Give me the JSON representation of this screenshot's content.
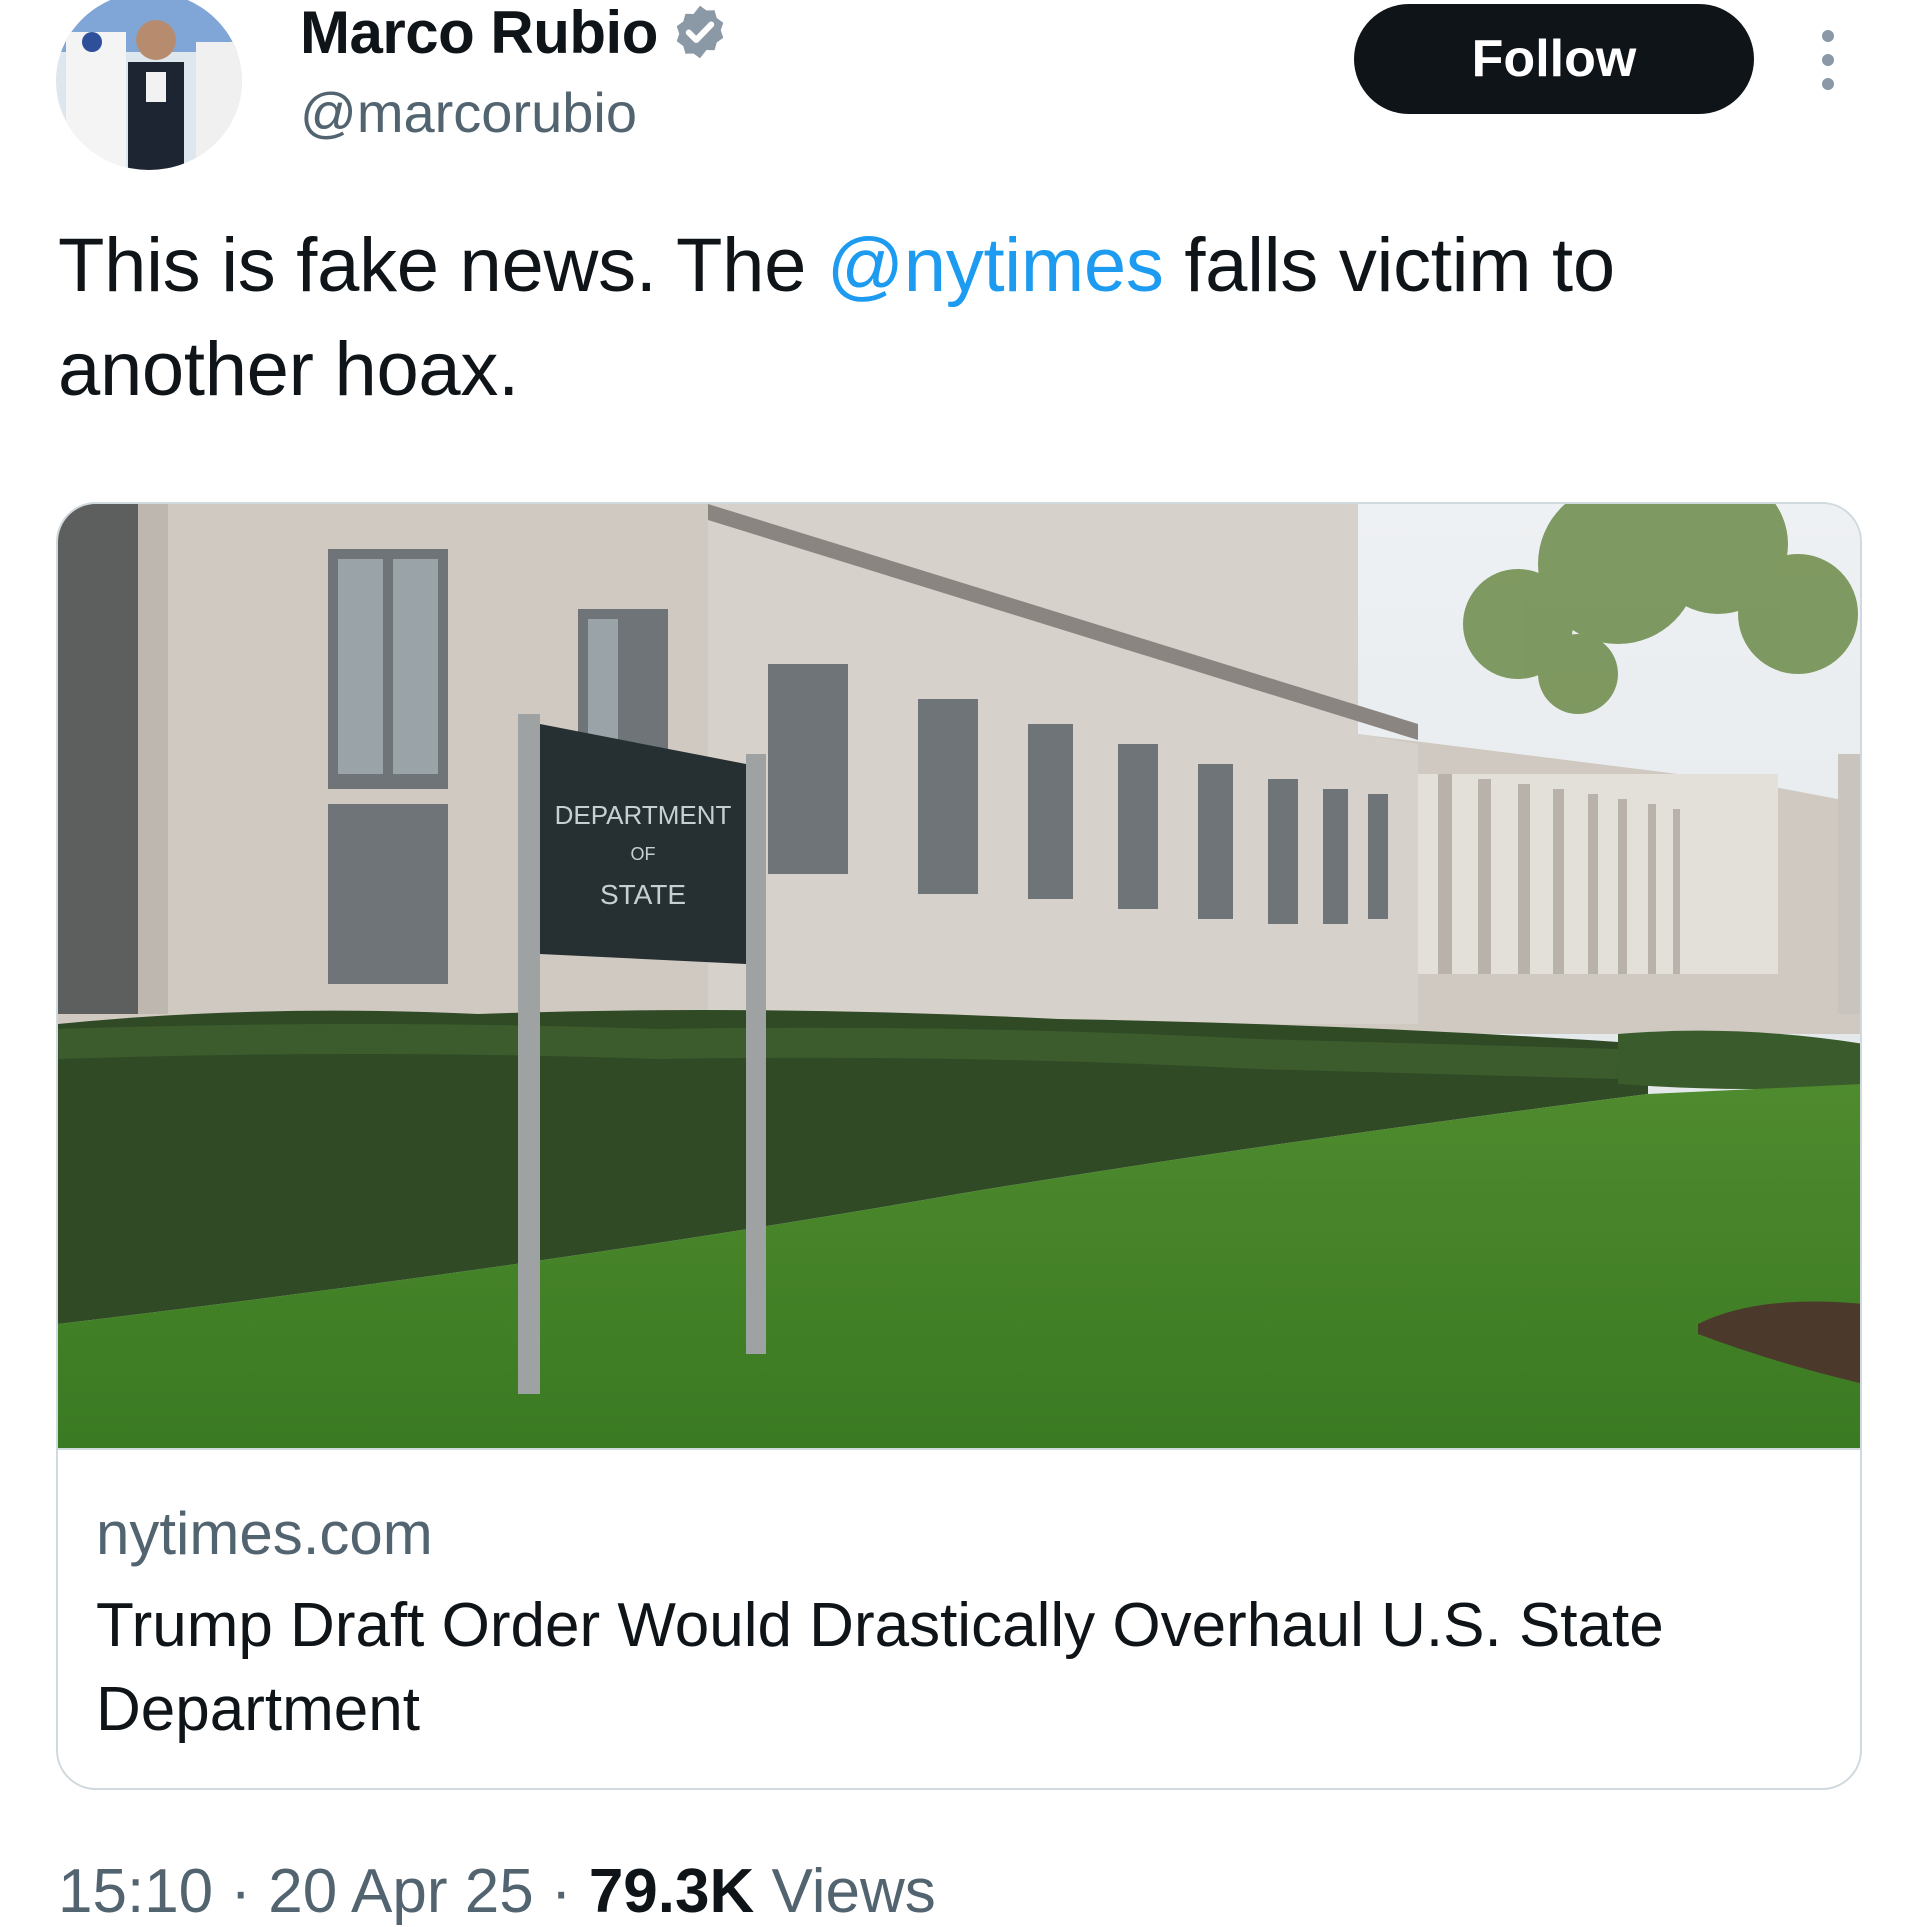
{
  "author": {
    "display_name": "Marco Rubio",
    "handle": "@marcorubio",
    "verified": true
  },
  "follow_button": {
    "label": "Follow"
  },
  "more_menu": {
    "icon": "more-options-icon"
  },
  "tweet": {
    "text_before": "This is fake news. The ",
    "mention": "@nytimes",
    "text_after": " falls victim to another hoax."
  },
  "link_card": {
    "image_sign_text_top": "DEPARTMENT",
    "image_sign_text_mid": "OF",
    "image_sign_text_bottom": "STATE",
    "domain": "nytimes.com",
    "title": "Trump Draft Order Would Drastically Overhaul U.S. State Department"
  },
  "meta": {
    "time": "15:10",
    "separator": " · ",
    "date": "20 Apr 25",
    "views_count": "79.3K",
    "views_label": " Views"
  },
  "colors": {
    "accent": "#1d9bf0",
    "text": "#0f1419",
    "muted": "#536471",
    "follow_bg": "#0f1419"
  }
}
